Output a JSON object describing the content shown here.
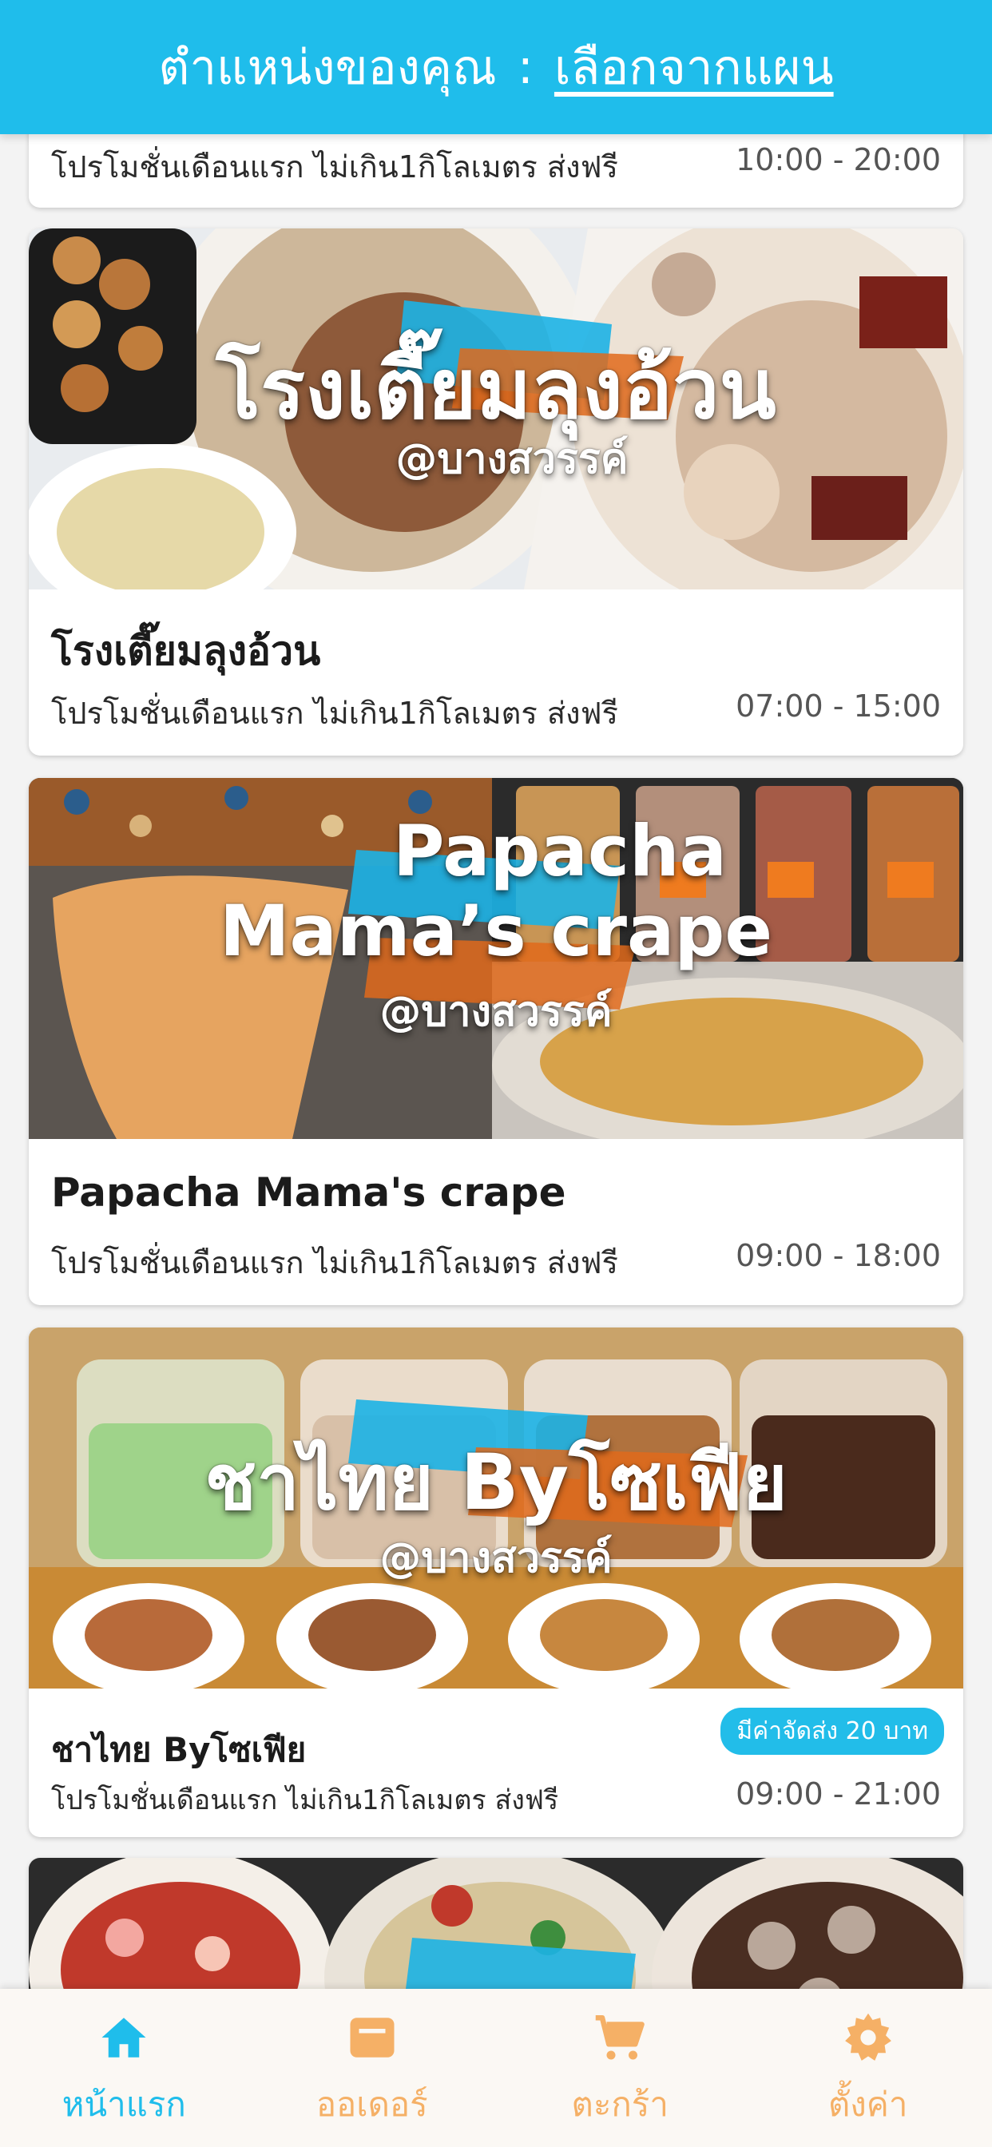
{
  "header": {
    "label": "ตำแหน่งของคุณ",
    "separator": ":",
    "link": "เลือกจากแผน"
  },
  "partial_card": {
    "promo": "โปรโมชั่นเดือนแรก ไม่เกิน1กิโลเมตร ส่งฟรี",
    "hours": "10:00 - 20:00"
  },
  "cards": [
    {
      "banner_title": "โรงเตี๊ยมลุงอ้วน",
      "banner_sub": "@บางสวรรค์",
      "name": "โรงเตี๊ยมลุงอ้วน",
      "promo": "โปรโมชั่นเดือนแรก ไม่เกิน1กิโลเมตร ส่งฟรี",
      "hours": "07:00 - 15:00"
    },
    {
      "banner_title_1": "Papacha",
      "banner_title_2": "Mama’s crape",
      "banner_sub": "@บางสวรรค์",
      "name": "Papacha Mama's crape",
      "promo": "โปรโมชั่นเดือนแรก ไม่เกิน1กิโลเมตร ส่งฟรี",
      "hours": "09:00 - 18:00"
    },
    {
      "banner_title": "ชาไทย Byโซเฟีย",
      "banner_sub": "@บางสวรรค์",
      "name": "ชาไทย Byโซเฟีย",
      "badge": "มีค่าจัดส่ง 20 บาท",
      "promo": "โปรโมชั่นเดือนแรก ไม่เกิน1กิโลเมตร ส่งฟรี",
      "hours": "09:00 - 21:00"
    }
  ],
  "bottom_nav": [
    {
      "label": "หน้าแรก",
      "icon": "home-icon",
      "active": true
    },
    {
      "label": "ออเดอร์",
      "icon": "order-icon",
      "active": false
    },
    {
      "label": "ตะกร้า",
      "icon": "cart-icon",
      "active": false
    },
    {
      "label": "ตั้งค่า",
      "icon": "gear-icon",
      "active": false
    }
  ],
  "colors": {
    "header": "#1fbdeb",
    "badge": "#22bde9",
    "nav_active": "#1fbdeb",
    "nav_inactive": "#f5b066"
  }
}
